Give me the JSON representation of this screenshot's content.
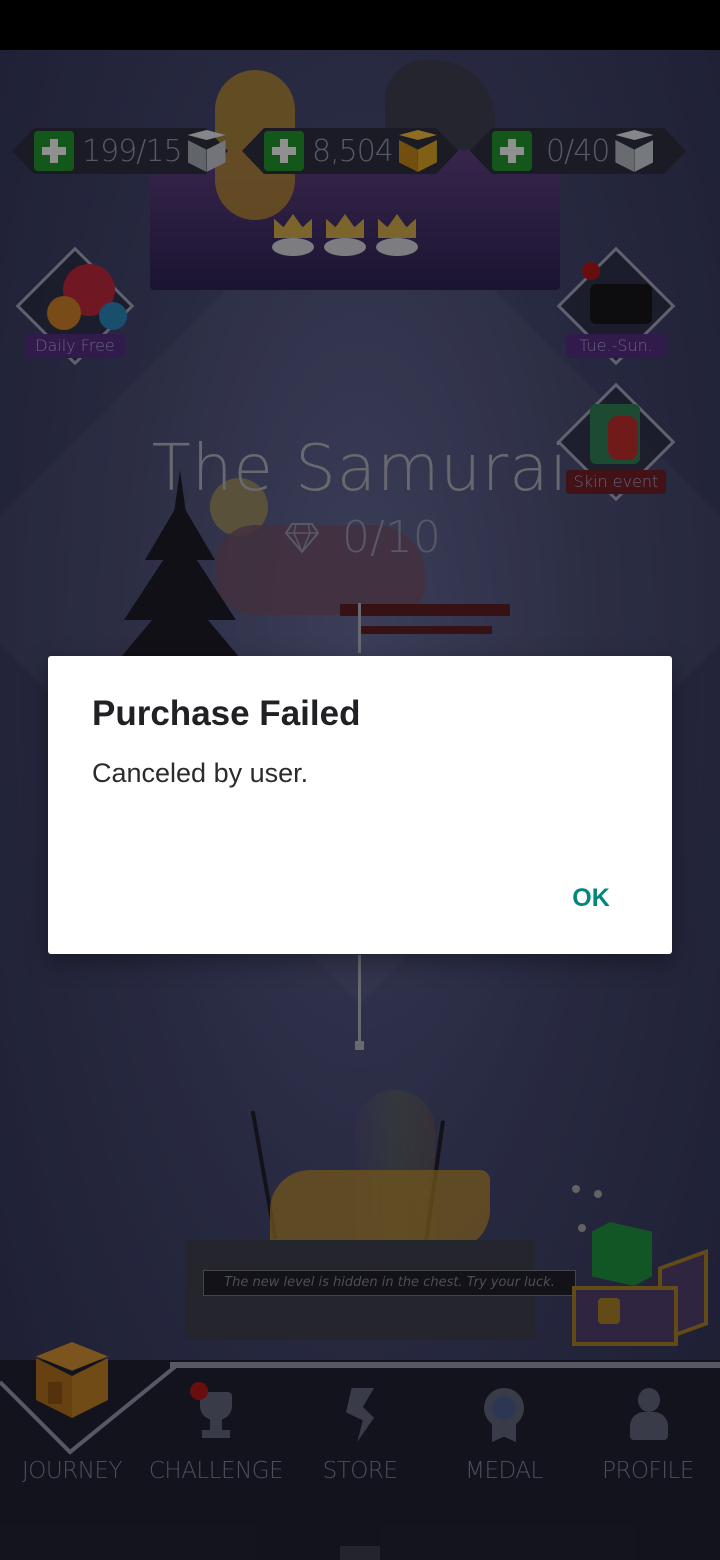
{
  "resources": [
    {
      "value": "199/15",
      "icon": "silver-cube-icon"
    },
    {
      "value": "8,504",
      "icon": "gold-cube-icon"
    },
    {
      "value": "0/40",
      "icon": "heart-cube-icon"
    }
  ],
  "side_buttons": {
    "daily_free": "Daily Free",
    "tue_sun": "Tue.-Sun.",
    "skin_event": "Skin event"
  },
  "level": {
    "title": "The Samurai",
    "progress": "0/10"
  },
  "hint": "The new level is hidden in the chest. Try your luck.",
  "nav": {
    "items": [
      {
        "label": "JOURNEY",
        "icon": "home-icon"
      },
      {
        "label": "CHALLENGE",
        "icon": "trophy-icon"
      },
      {
        "label": "STORE",
        "icon": "store-icon"
      },
      {
        "label": "MEDAL",
        "icon": "medal-icon"
      },
      {
        "label": "PROFILE",
        "icon": "profile-icon"
      }
    ]
  },
  "dialog": {
    "title": "Purchase Failed",
    "message": "Canceled by user.",
    "ok_label": "OK"
  },
  "colors": {
    "accent": "#00897b",
    "plus_green": "#1f8f2b",
    "dialog_bg": "#ffffff"
  }
}
